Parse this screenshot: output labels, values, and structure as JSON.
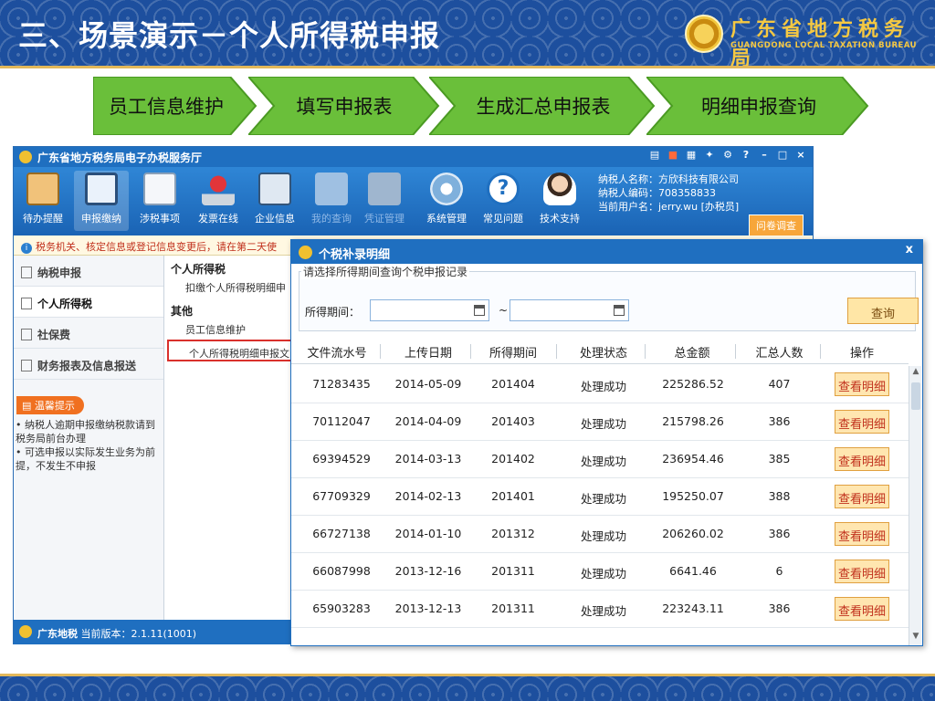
{
  "slide": {
    "title": "三、场景演示－个人所得税申报",
    "logo_cn": "广东省地方税务局",
    "logo_en": "GUANGDONG LOCAL TAXATION BUREAU"
  },
  "steps": [
    "员工信息维护",
    "填写申报表",
    "生成汇总申报表",
    "明细申报查询"
  ],
  "colors": {
    "step_fill": "#6abf3a",
    "title_blue": "#1f6fc0",
    "header_blue": "#1d4f9e",
    "accent_orange": "#f07020",
    "button_gold": "#ffe6a6",
    "warn_red": "#c0301c"
  },
  "app": {
    "title": "广东省地方税务局电子办税服务厅",
    "toolbar": [
      {
        "label": "待办提醒",
        "icon": "clipboard-icon"
      },
      {
        "label": "申报缴纳",
        "icon": "monitor-icon"
      },
      {
        "label": "涉税事项",
        "icon": "form-icon"
      },
      {
        "label": "发票在线",
        "icon": "stamp-icon"
      },
      {
        "label": "企业信息",
        "icon": "building-icon"
      },
      {
        "label": "我的查询",
        "icon": "magnifier-icon"
      },
      {
        "label": "凭证管理",
        "icon": "books-icon"
      },
      {
        "label": "系统管理",
        "icon": "gear-icon"
      },
      {
        "label": "常见问题",
        "icon": "question-icon"
      },
      {
        "label": "技术支持",
        "icon": "support-agent-icon"
      }
    ],
    "taxpayer_name": "纳税人名称：方欣科技有限公司",
    "taxpayer_code": "纳税人编码：708358833",
    "current_user": "当前用户名：jerry.wu [办税员]",
    "survey_button": "问卷调查",
    "notice": "税务机关、核定信息或登记信息变更后，请在第二天使",
    "left_nav": [
      "纳税申报",
      "个人所得税",
      "社保费",
      "财务报表及信息报送"
    ],
    "tips_title": "温馨提示",
    "tips": [
      "纳税人逾期申报缴纳税款请到税务局前台办理",
      "可选申报以实际发生业务为前提，不发生不申报"
    ],
    "mid_groups": [
      {
        "title": "个人所得税",
        "items": [
          "扣缴个人所得税明细申"
        ]
      },
      {
        "title": "其他",
        "items": [
          "员工信息维护",
          "个人所得税明细申报文"
        ]
      }
    ],
    "status_brand": "广东地税",
    "status_version": "当前版本：2.1.11(1001)"
  },
  "dialog": {
    "title": "个税补录明细",
    "close": "x",
    "query_legend": "请选择所得期间查询个税申报记录",
    "period_label": "所得期间：",
    "from_value": "",
    "to_value": "",
    "range_sep": "~",
    "query_button": "查询",
    "columns": [
      "文件流水号",
      "上传日期",
      "所得期间",
      "处理状态",
      "总金额",
      "汇总人数",
      "操作"
    ],
    "rows": [
      {
        "id": "71283435",
        "date": "2014-05-09",
        "period": "201404",
        "status": "处理成功",
        "amount": "225286.52",
        "count": "407",
        "action": "查看明细"
      },
      {
        "id": "70112047",
        "date": "2014-04-09",
        "period": "201403",
        "status": "处理成功",
        "amount": "215798.26",
        "count": "386",
        "action": "查看明细"
      },
      {
        "id": "69394529",
        "date": "2014-03-13",
        "period": "201402",
        "status": "处理成功",
        "amount": "236954.46",
        "count": "385",
        "action": "查看明细"
      },
      {
        "id": "67709329",
        "date": "2014-02-13",
        "period": "201401",
        "status": "处理成功",
        "amount": "195250.07",
        "count": "388",
        "action": "查看明细"
      },
      {
        "id": "66727138",
        "date": "2014-01-10",
        "period": "201312",
        "status": "处理成功",
        "amount": "206260.02",
        "count": "386",
        "action": "查看明细"
      },
      {
        "id": "66087998",
        "date": "2013-12-16",
        "period": "201311",
        "status": "处理成功",
        "amount": "6641.46",
        "count": "6",
        "action": "查看明细"
      },
      {
        "id": "65903283",
        "date": "2013-12-13",
        "period": "201311",
        "status": "处理成功",
        "amount": "223243.11",
        "count": "386",
        "action": "查看明细"
      }
    ]
  }
}
